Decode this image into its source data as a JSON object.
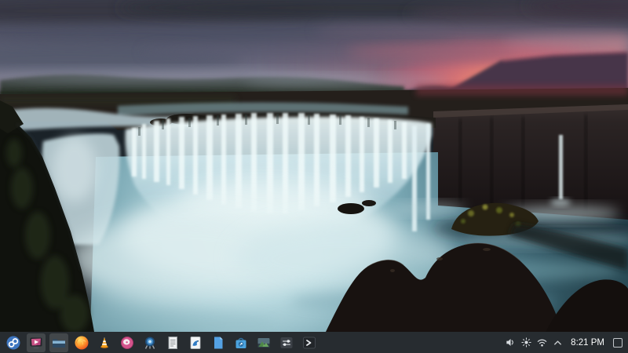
{
  "desktop": {
    "wallpaper": "waterfall-horseshoe-falls-at-sunset"
  },
  "taskbar": {
    "launcher": {
      "title": "Application Launcher",
      "icon": "fedora-logo-icon"
    },
    "apps": [
      {
        "icon": "media-player-icon",
        "title": "Media Player",
        "running": true
      },
      {
        "icon": "file-manager-icon",
        "title": "File Manager",
        "running": true
      },
      {
        "icon": "firefox-icon",
        "title": "Firefox Web Browser"
      },
      {
        "icon": "vlc-icon",
        "title": "VLC Media Player"
      },
      {
        "icon": "music-player-icon",
        "title": "Music Player"
      },
      {
        "icon": "camera-icon",
        "title": "Camera"
      },
      {
        "icon": "text-document-icon",
        "title": "Text Editor"
      },
      {
        "icon": "kate-icon",
        "title": "Kate"
      },
      {
        "icon": "blue-document-icon",
        "title": "Documents"
      },
      {
        "icon": "discover-icon",
        "title": "Discover Software Center"
      },
      {
        "icon": "image-viewer-icon",
        "title": "Image Viewer"
      },
      {
        "icon": "settings-sliders-icon",
        "title": "Settings"
      },
      {
        "icon": "terminal-icon",
        "title": "Terminal"
      }
    ],
    "tray": {
      "volume_title": "Audio Volume",
      "brightness_title": "Brightness",
      "network_title": "Wi-Fi Network",
      "expand_title": "Expand System Tray"
    },
    "clock": {
      "time": "8:21 PM"
    },
    "show_desktop_title": "Show Desktop",
    "colors": {
      "panel_bg": "#282c31",
      "panel_text": "#fbfcfc",
      "fedora_blue": "#3e76c0"
    }
  }
}
